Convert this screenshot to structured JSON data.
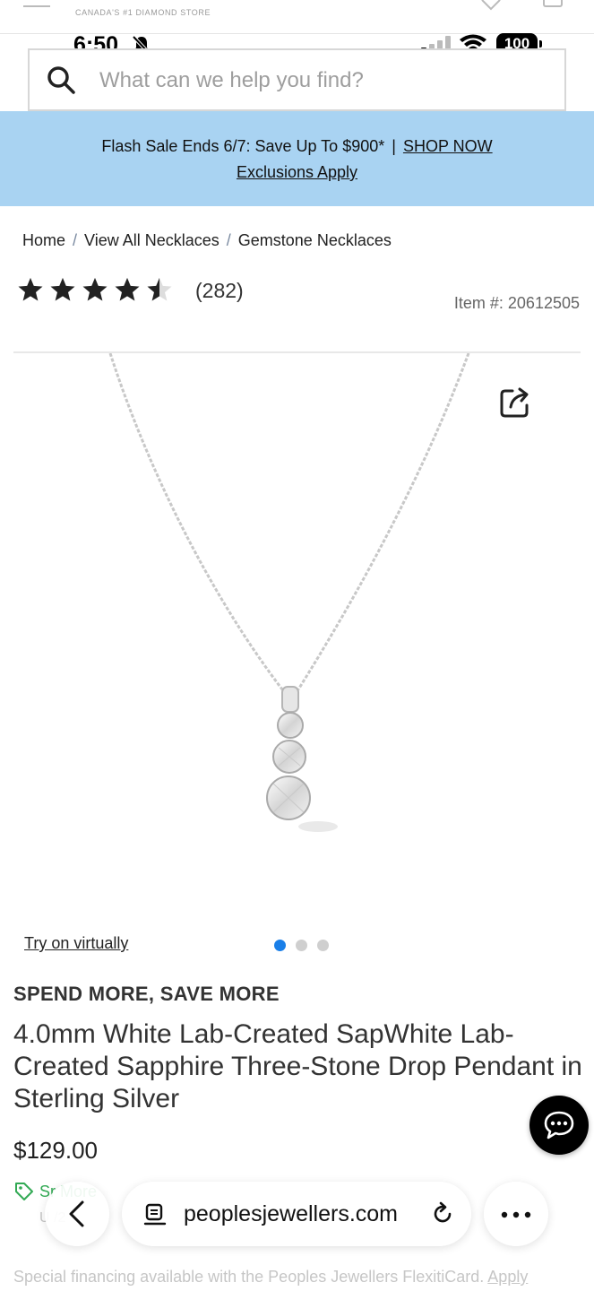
{
  "site_header": {
    "tagline": "CANADA'S #1 DIAMOND STORE"
  },
  "status_bar": {
    "time": "6:50",
    "battery": "100"
  },
  "search": {
    "placeholder": "What can we help you find?"
  },
  "promo": {
    "text": "Flash Sale Ends 6/7: Save Up To $900*",
    "separator": "|",
    "cta": "SHOP NOW",
    "exclusions": "Exclusions Apply"
  },
  "breadcrumb": {
    "items": [
      "Home",
      "View All Necklaces",
      "Gemstone Necklaces"
    ],
    "separator": "/"
  },
  "rating": {
    "stars": 4.5,
    "count": "(282)"
  },
  "item_number": "Item #: 20612505",
  "gallery": {
    "try_on": "Try on virtually",
    "slide_count": 3,
    "active_slide": 1
  },
  "product": {
    "promo_tag": "SPEND MORE, SAVE MORE",
    "title": "4.0mm White Lab-Created SapWhite Lab-Created Sapphire Three-Stone Drop Pendant in Sterling Silver",
    "price": "$129.00",
    "spend_more_partial": "Sr    More",
    "faded_line_partial": "U             /2"
  },
  "financing": {
    "text": "Special financing available with the Peoples Jewellers FlexitiCard.",
    "link": "Apply"
  },
  "browser": {
    "url": "peoplesjewellers.com"
  },
  "colors": {
    "promo_bg": "#a9d3f2",
    "active_dot": "#1a7fe8",
    "spend_more_green": "#33aa55"
  }
}
